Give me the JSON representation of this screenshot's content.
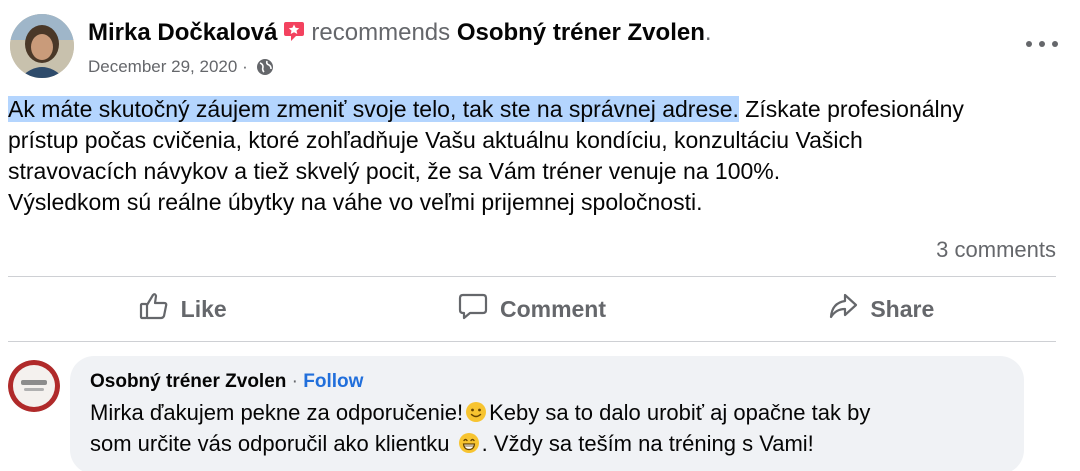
{
  "post": {
    "author": "Mirka Dočkalová",
    "verb": "recommends",
    "page_name": "Osobný tréner Zvolen",
    "period": ".",
    "date": "December 29, 2020",
    "meta_separator": "·",
    "body": {
      "line1_highlight": "Ak máte skutočný záujem zmeniť svoje telo, tak ste na správnej adrese.",
      "line1_rest": " Získate profesionálny",
      "line2": "prístup počas cvičenia, ktoré zohľadňuje Vašu aktuálnu  kondíciu, konzultáciu Vašich",
      "line3": "stravovacích návykov a tiež skvelý pocit, že sa Vám tréner venuje na  100%.",
      "line4": "Výsledkom sú reálne úbytky na váhe vo veľmi prijemnej spoločnosti."
    },
    "comments_count": "3 comments",
    "highlight_color": "#b4d5fe"
  },
  "actions": {
    "like": "Like",
    "comment": "Comment",
    "share": "Share"
  },
  "comment": {
    "author": "Osobný tréner Zvolen",
    "separator": "·",
    "follow": "Follow",
    "line1_a": "Mirka ďakujem pekne za odporučenie!",
    "line1_b": "Keby sa to dalo urobiť aj opačne tak by",
    "line2_a": "som určite vás odporučil ako klientku",
    "line2_b": ". Vždy sa teším na tréning s Vami!",
    "emoji_1": "slightly-smiling-face",
    "emoji_2": "grinning-face"
  },
  "icons": {
    "recommend_badge": "recommend-star-icon",
    "privacy": "globe-icon",
    "more": "more-options-icon"
  },
  "colors": {
    "brand_link": "#216fdb",
    "recommend_badge": "#f3425f",
    "secondary_text": "#65676b"
  }
}
